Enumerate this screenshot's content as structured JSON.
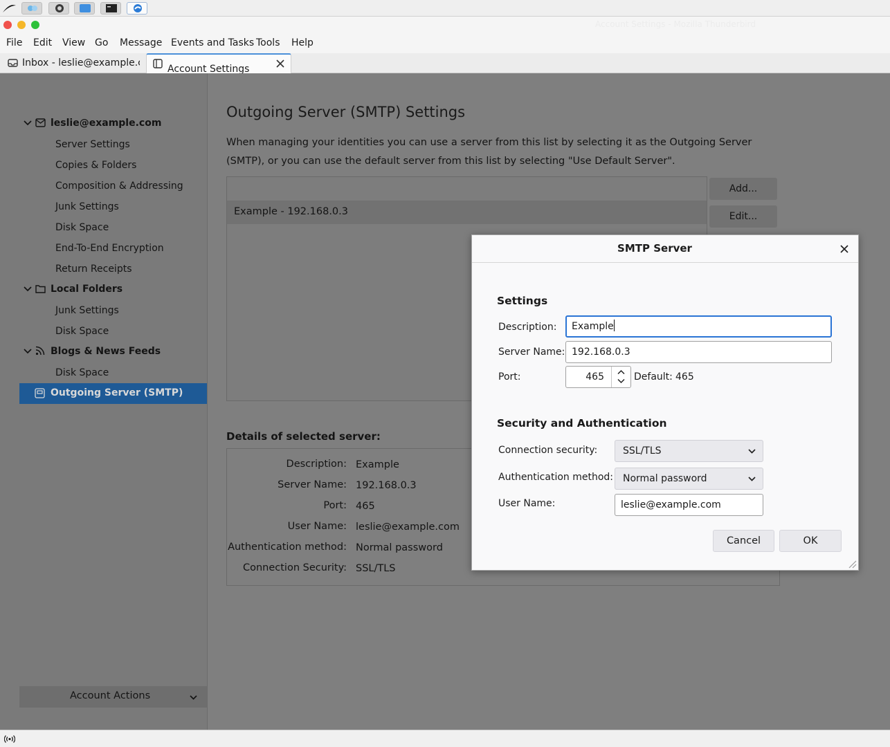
{
  "window": {
    "title": "Account Settings - Mozilla Thunderbird"
  },
  "menubar": {
    "file": "File",
    "edit": "Edit",
    "view": "View",
    "go": "Go",
    "message": "Message",
    "events": "Events and Tasks",
    "tools": "Tools",
    "help": "Help"
  },
  "tabs": [
    {
      "label": "Inbox - leslie@example.com"
    },
    {
      "label": "Account Settings"
    }
  ],
  "sidebar": {
    "account_email": "leslie@example.com",
    "account_items": [
      "Server Settings",
      "Copies & Folders",
      "Composition & Addressing",
      "Junk Settings",
      "Disk Space",
      "End-To-End Encryption",
      "Return Receipts"
    ],
    "local_folders": "Local Folders",
    "local_items": [
      "Junk Settings",
      "Disk Space"
    ],
    "blogs": "Blogs & News Feeds",
    "blogs_items": [
      "Disk Space"
    ],
    "smtp": "Outgoing Server (SMTP)",
    "account_actions": "Account Actions"
  },
  "page": {
    "title": "Outgoing Server (SMTP) Settings",
    "description": "When managing your identities you can use a server from this list by selecting it as the Outgoing Server (SMTP), or you can use the default server from this list by selecting \"Use Default Server\".",
    "server_row": "Example - 192.168.0.3",
    "add_button": "Add...",
    "edit_button": "Edit...",
    "details_title": "Details of selected server:",
    "details": [
      {
        "label": "Description:",
        "value": "Example"
      },
      {
        "label": "Server Name:",
        "value": "192.168.0.3"
      },
      {
        "label": "Port:",
        "value": "465"
      },
      {
        "label": "User Name:",
        "value": "leslie@example.com"
      },
      {
        "label": "Authentication method:",
        "value": "Normal password"
      },
      {
        "label": "Connection Security:",
        "value": "SSL/TLS"
      }
    ]
  },
  "dialog": {
    "title": "SMTP Server",
    "settings_heading": "Settings",
    "description_label": "Description:",
    "description_value": "Example",
    "server_name_label": "Server Name:",
    "server_name_value": "192.168.0.3",
    "port_label": "Port:",
    "port_value": "465",
    "default_label": "Default:",
    "default_value": "465",
    "security_heading": "Security and Authentication",
    "connection_security_label": "Connection security:",
    "connection_security_value": "SSL/TLS",
    "auth_method_label": "Authentication method:",
    "auth_method_value": "Normal password",
    "user_name_label": "User Name:",
    "user_name_value": "leslie@example.com",
    "cancel_button": "Cancel",
    "ok_button": "OK"
  },
  "colors": {
    "accent": "#2a74d5",
    "selected_sidebar": "#1e5a96"
  }
}
